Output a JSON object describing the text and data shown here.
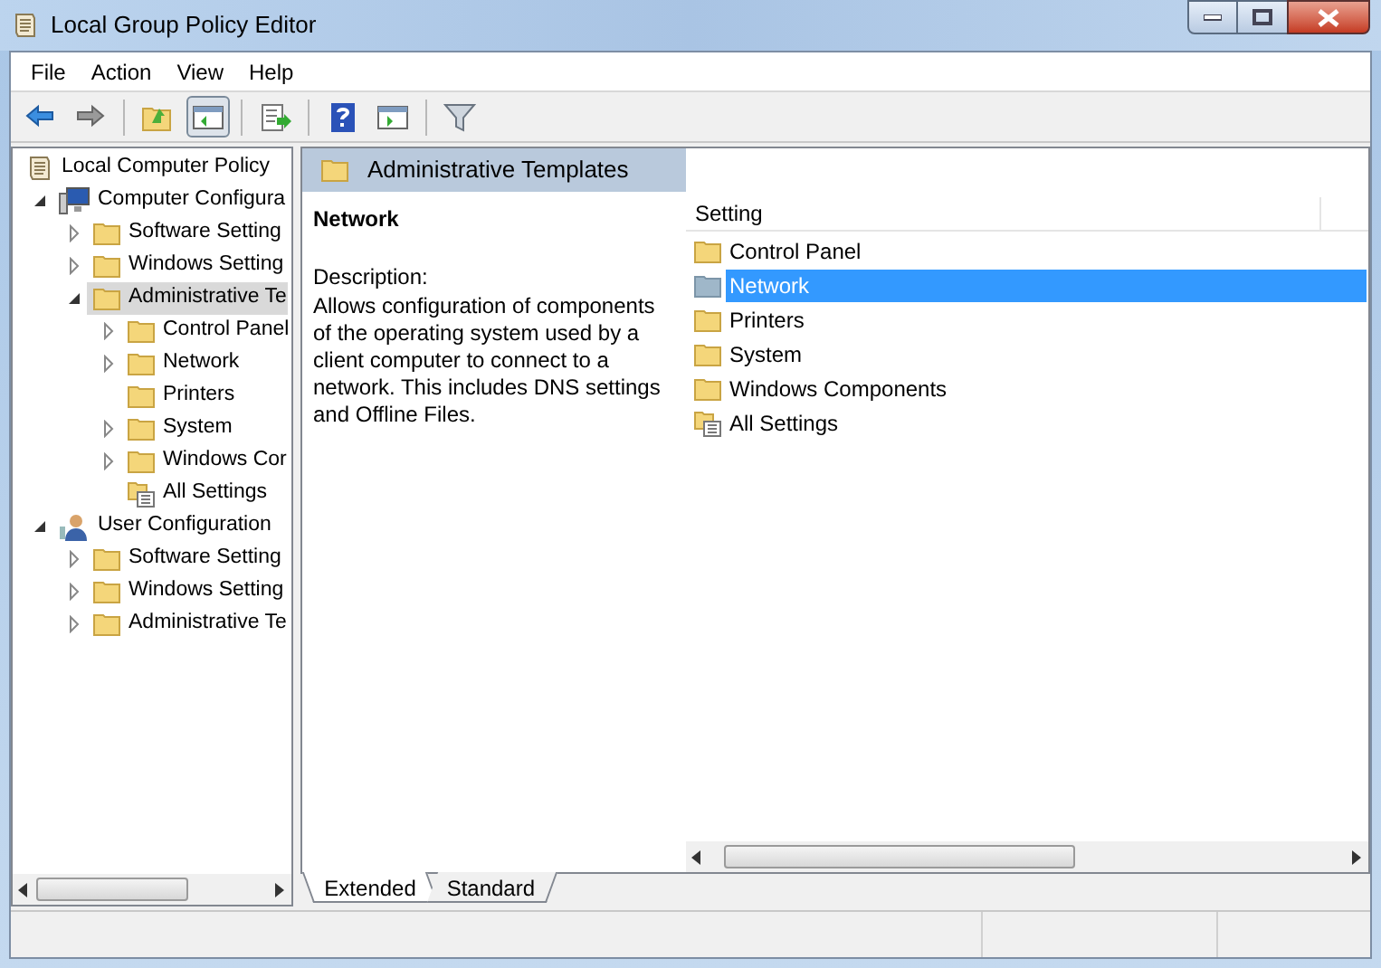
{
  "window": {
    "title": "Local Group Policy Editor"
  },
  "menu": [
    "File",
    "Action",
    "View",
    "Help"
  ],
  "toolbar": [
    {
      "kind": "back"
    },
    {
      "kind": "forward"
    },
    {
      "kind": "sep"
    },
    {
      "kind": "up"
    },
    {
      "kind": "pane",
      "selected": true
    },
    {
      "kind": "sep"
    },
    {
      "kind": "export"
    },
    {
      "kind": "sep"
    },
    {
      "kind": "help"
    },
    {
      "kind": "pane2"
    },
    {
      "kind": "sep"
    },
    {
      "kind": "filter"
    }
  ],
  "tree": [
    {
      "label": "Local Computer Policy",
      "kind": "policy",
      "selected": false,
      "children": [
        {
          "label": "Computer Configura",
          "kind": "computer",
          "expanded": true,
          "selected": false,
          "children": [
            {
              "label": "Software Setting",
              "kind": "folder",
              "expanded": false,
              "selected": false
            },
            {
              "label": "Windows Setting",
              "kind": "folder",
              "expanded": false,
              "selected": false
            },
            {
              "label": "Administrative Te",
              "kind": "folder",
              "expanded": true,
              "selected": true,
              "children": [
                {
                  "label": "Control Panel",
                  "kind": "folder",
                  "expanded": false,
                  "selected": false
                },
                {
                  "label": "Network",
                  "kind": "folder",
                  "expanded": false,
                  "selected": false
                },
                {
                  "label": "Printers",
                  "kind": "folder",
                  "selected": false
                },
                {
                  "label": "System",
                  "kind": "folder",
                  "expanded": false,
                  "selected": false
                },
                {
                  "label": "Windows Cor",
                  "kind": "folder",
                  "expanded": false,
                  "selected": false
                },
                {
                  "label": "All Settings",
                  "kind": "all-settings",
                  "selected": false
                }
              ]
            }
          ]
        },
        {
          "label": "User Configuration",
          "kind": "user",
          "expanded": true,
          "selected": false,
          "children": [
            {
              "label": "Software Setting",
              "kind": "folder",
              "expanded": false,
              "selected": false
            },
            {
              "label": "Windows Setting",
              "kind": "folder",
              "expanded": false,
              "selected": false
            },
            {
              "label": "Administrative Te",
              "kind": "folder",
              "expanded": false,
              "selected": false
            }
          ]
        }
      ]
    }
  ],
  "header": {
    "title": "Administrative Templates"
  },
  "description": {
    "title": "Network",
    "label": "Description:",
    "text": "Allows configuration of components of the operating system used by a client computer to connect to a network. This includes DNS settings and Offline Files."
  },
  "list": {
    "column": "Setting",
    "items": [
      {
        "label": "Control Panel",
        "kind": "folder",
        "selected": false
      },
      {
        "label": "Network",
        "kind": "folder",
        "selected": true
      },
      {
        "label": "Printers",
        "kind": "folder",
        "selected": false
      },
      {
        "label": "System",
        "kind": "folder",
        "selected": false
      },
      {
        "label": "Windows Components",
        "kind": "folder",
        "selected": false
      },
      {
        "label": "All Settings",
        "kind": "all-settings",
        "selected": false
      }
    ]
  },
  "tabs": [
    {
      "label": "Extended",
      "selected": true
    },
    {
      "label": "Standard",
      "selected": false
    }
  ]
}
